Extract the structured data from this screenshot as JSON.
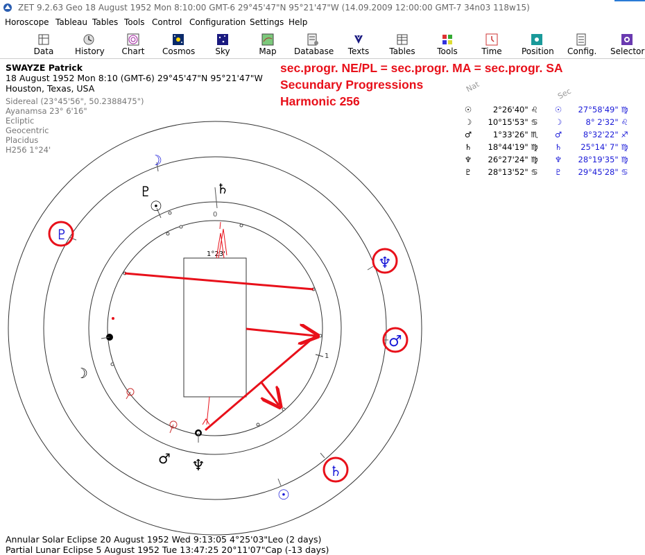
{
  "window": {
    "title": "ZET 9.2.63 Geo    18 August 1952  Mon   8:10:00 GMT-6 29°45'47\"N  95°21'47\"W  (14.09.2009  12:00:00 GMT-7 34n03 118w15)",
    "accent_color": "#2a7bd6"
  },
  "menu": [
    "Horoscope",
    "Tableau",
    "Tables",
    "Tools",
    "Control",
    "Configuration",
    "Settings",
    "Help"
  ],
  "toolbar": [
    {
      "label": "Data",
      "icon": "data-icon"
    },
    {
      "label": "History",
      "icon": "history-icon"
    },
    {
      "label": "Chart",
      "icon": "chart-icon"
    },
    {
      "label": "Cosmos",
      "icon": "cosmos-icon"
    },
    {
      "label": "Sky",
      "icon": "sky-icon"
    },
    {
      "label": "Map",
      "icon": "map-icon"
    },
    {
      "label": "Database",
      "icon": "database-icon"
    },
    {
      "label": "Texts",
      "icon": "texts-icon"
    },
    {
      "label": "Tables",
      "icon": "tables-icon"
    },
    {
      "label": "Tools",
      "icon": "tools-icon"
    },
    {
      "label": "Time",
      "icon": "time-icon"
    },
    {
      "label": "Position",
      "icon": "position-icon"
    },
    {
      "label": "Config.",
      "icon": "config-icon"
    },
    {
      "label": "Selector",
      "icon": "selector-icon"
    }
  ],
  "person": {
    "name": "SWAYZE Patrick",
    "datetime": "18 August 1952  Mon   8:10 (GMT-6) 29°45'47\"N  95°21'47\"W",
    "place": "Houston, Texas, USA",
    "settings": [
      "Sidereal (23°45'56\", 50.2388475\")",
      "Ayanamsa 23° 6'16\"",
      "Ecliptic",
      "Geocentric",
      "Placidus",
      "H256   1°24'"
    ]
  },
  "headline": [
    "sec.progr. NE/PL = sec.progr. MA = sec.progr. SA",
    "Secundary Progressions",
    "Harmonic 256"
  ],
  "headline_color": "#e8101a",
  "table": {
    "nat_header": "Nat",
    "sec_header": "Sec",
    "nat": [
      {
        "planet": "☉",
        "pos": " 2°26'40\"",
        "sign": "♌"
      },
      {
        "planet": "☽",
        "pos": "10°15'53\"",
        "sign": "♋"
      },
      {
        "planet": "♂",
        "pos": " 1°33'26\"",
        "sign": "♏"
      },
      {
        "planet": "♄",
        "pos": "18°44'19\"",
        "sign": "♍"
      },
      {
        "planet": "♆",
        "pos": "26°27'24\"",
        "sign": "♍"
      },
      {
        "planet": "♇",
        "pos": "28°13'52\"",
        "sign": "♋"
      }
    ],
    "sec": [
      {
        "planet": "☉",
        "pos": "27°58'49\"",
        "sign": "♍"
      },
      {
        "planet": "☽",
        "pos": " 8° 2'32\"",
        "sign": "♌"
      },
      {
        "planet": "♂",
        "pos": " 8°32'22\"",
        "sign": "♐"
      },
      {
        "planet": "♄",
        "pos": "25°14' 7\"",
        "sign": "♍"
      },
      {
        "planet": "♆",
        "pos": "28°19'35\"",
        "sign": "♍"
      },
      {
        "planet": "♇",
        "pos": "29°45'28\"",
        "sign": "♋"
      }
    ],
    "sec_color": "#1a1ad8"
  },
  "wheel": {
    "center_label": "1°23'",
    "inner_top_label": "0",
    "inner_right_label": "1",
    "outer_planets": [
      {
        "name": "moon",
        "glyph": "☽",
        "circled": false
      },
      {
        "name": "pluto",
        "glyph": "♇",
        "circled": true
      },
      {
        "name": "neptune",
        "glyph": "♆",
        "circled": true
      },
      {
        "name": "mars",
        "glyph": "♂",
        "circled": true
      },
      {
        "name": "saturn",
        "glyph": "♄",
        "circled": true
      },
      {
        "name": "sun",
        "glyph": "☉",
        "circled": false
      }
    ],
    "inner_planets": [
      {
        "name": "pluto",
        "glyph": "♇"
      },
      {
        "name": "sun",
        "glyph": "☉"
      },
      {
        "name": "saturn",
        "glyph": "♄"
      },
      {
        "name": "moon",
        "glyph": "☽"
      },
      {
        "name": "mars",
        "glyph": "♂"
      },
      {
        "name": "neptune",
        "glyph": "♆"
      }
    ]
  },
  "footer": [
    "Annular Solar Eclipse 20 August 1952 Wed  9:13:05  4°25'03\"Leo (2 days)",
    "Partial Lunar Eclipse 5 August 1952 Tue 13:47:25 20°11'07\"Cap (-13 days)"
  ]
}
